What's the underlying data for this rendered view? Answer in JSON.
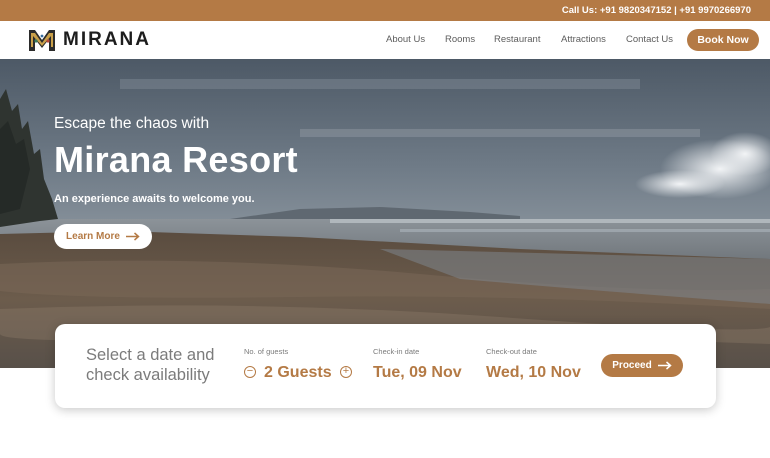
{
  "topbar": {
    "contact": "Call Us: +91 9820347152 | +91 9970266970"
  },
  "header": {
    "logo_text": "MIRANA",
    "nav": [
      "About Us",
      "Rooms",
      "Restaurant",
      "Attractions",
      "Contact Us"
    ],
    "book_label": "Book Now"
  },
  "hero": {
    "kicker": "Escape the chaos with",
    "title": "Mirana Resort",
    "subtitle": "An experience awaits to welcome you.",
    "cta_label": "Learn More"
  },
  "availability": {
    "title": "Select a date and check availability",
    "guests_label": "No. of guests",
    "guests_value": "2 Guests",
    "checkin_label": "Check-in date",
    "checkin_value": "Tue, 09 Nov",
    "checkout_label": "Check-out date",
    "checkout_value": "Wed, 10 Nov",
    "proceed_label": "Proceed"
  },
  "colors": {
    "accent": "#b47a45",
    "text_muted": "#7b7b7b"
  },
  "icons": {
    "arrow": "arrow-right-icon",
    "minus": "minus-circle-icon",
    "plus": "plus-circle-icon",
    "logo": "mirana-logo-icon"
  }
}
